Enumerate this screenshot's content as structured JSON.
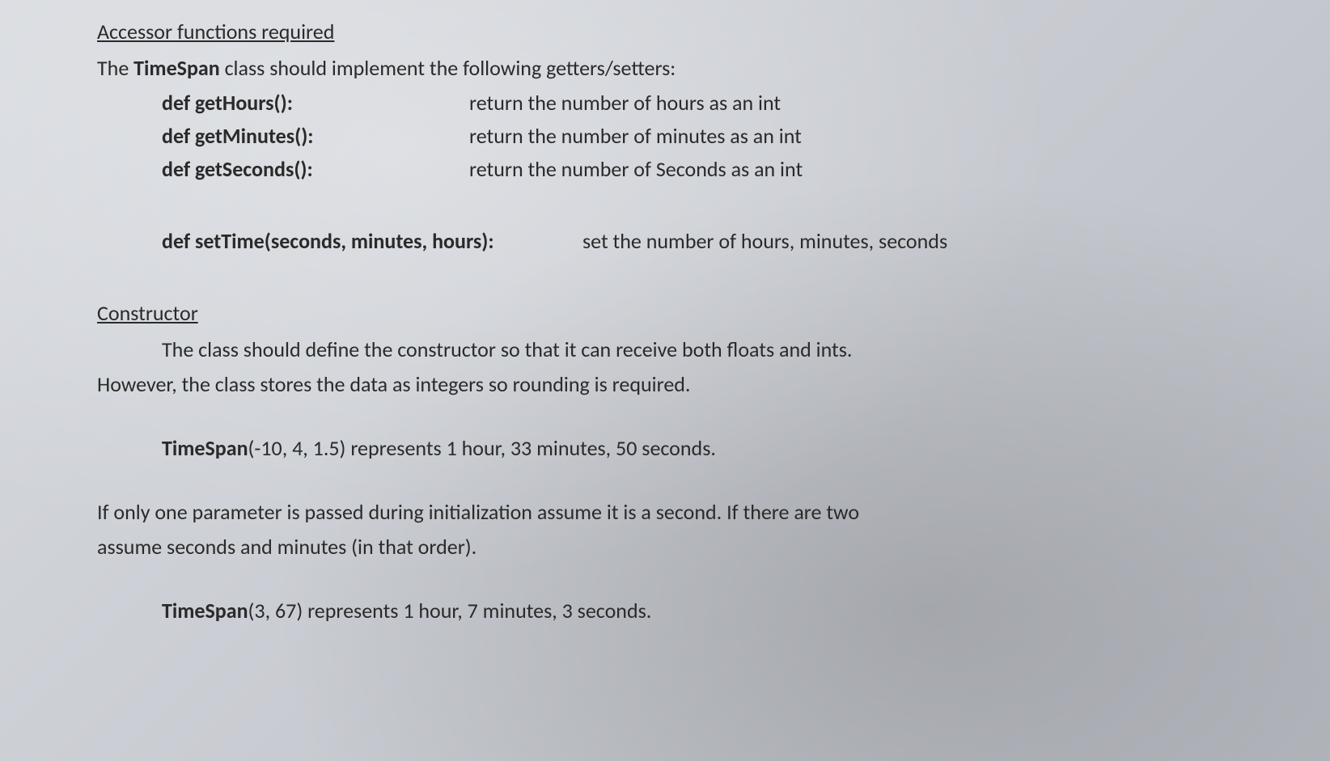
{
  "section1": {
    "heading": "Accessor functions required",
    "intro_prefix": "The ",
    "intro_class": "TimeSpan",
    "intro_suffix": " class should implement the following getters/setters:",
    "methods": [
      {
        "sig": "def getHours():",
        "desc": "return the number of hours as an int"
      },
      {
        "sig": "def getMinutes():",
        "desc": "return the number of minutes as an int"
      },
      {
        "sig": "def getSeconds():",
        "desc": "return the number of Seconds as an int"
      }
    ],
    "setter": {
      "sig": "def setTime(seconds, minutes, hours):",
      "desc": "set the number of hours, minutes, seconds"
    }
  },
  "section2": {
    "heading": "Constructor",
    "para1_line1": "The class should define the constructor so that it can receive both floats and ints.",
    "para1_line2": "However, the class stores the data as integers so rounding is required.",
    "example1_class": "TimeSpan",
    "example1_args": "(-10, 4, 1.5) represents 1 hour, 33 minutes, 50 seconds.",
    "para2_line1": "If only one parameter is passed during initialization assume it is a second.  If there are two",
    "para2_line2": "assume seconds and minutes (in that order).",
    "example2_class": "TimeSpan",
    "example2_args": "(3, 67) represents 1 hour, 7 minutes, 3 seconds."
  }
}
